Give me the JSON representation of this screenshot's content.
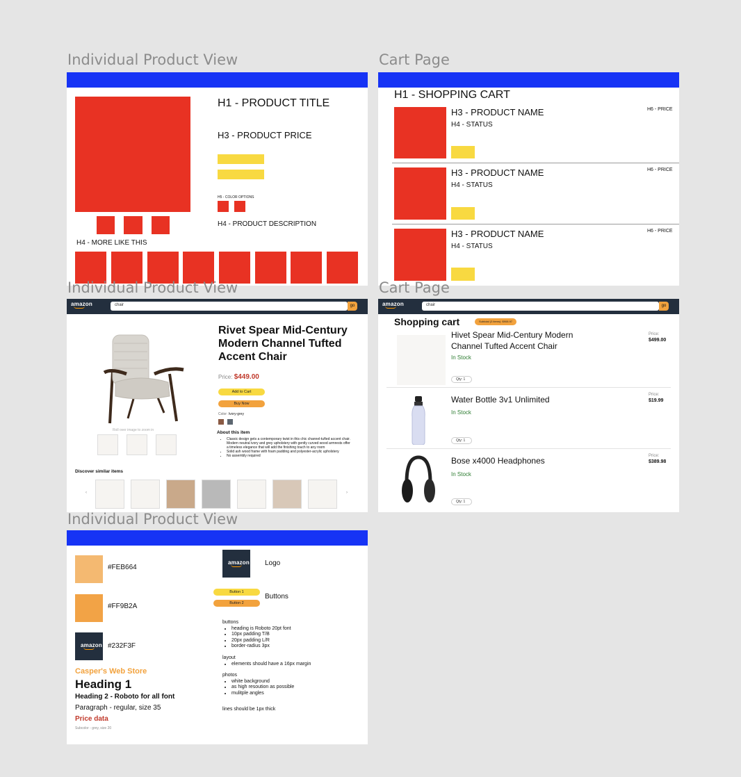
{
  "frames": {
    "wire_product_label": "Individual Product View",
    "wire_cart_label": "Cart Page",
    "hifi_product_label": "Individual Product View",
    "hifi_cart_label": "Cart Page",
    "style_label": "Individual Product View"
  },
  "wire_product": {
    "title": "H1 - PRODUCT TITLE",
    "price": "H3 - PRODUCT PRICE",
    "color_options": "H5 - COLOR OPTIONS",
    "description": "H4 - PRODUCT DESCRIPTION",
    "more_like": "H4 - MORE LIKE THIS"
  },
  "wire_cart": {
    "title": "H1 - SHOPPING CART",
    "items": [
      {
        "name": "H3 - PRODUCT NAME",
        "status": "H4 - STATUS",
        "price": "H6 - PRICE"
      },
      {
        "name": "H3 - PRODUCT NAME",
        "status": "H4 - STATUS",
        "price": "H6 - PRICE"
      },
      {
        "name": "H3 - PRODUCT NAME",
        "status": "H4 - STATUS",
        "price": "H6 - PRICE"
      }
    ]
  },
  "nav": {
    "logo": "amazon",
    "search_value": "chair",
    "go": "go"
  },
  "product": {
    "title": "Rivet Spear Mid-Century Modern Channel Tufted Accent Chair",
    "price_label": "Price:",
    "price": "$449.00",
    "add_to_cart": "Add to Cart",
    "buy_now": "Buy Now",
    "color_label": "Color:",
    "color_value": "Ivory-grey",
    "rollover": "Roll over image to zoom in",
    "about_title": "About this item",
    "about": [
      "Classic design gets a contemporary twist in this chic channel-tufted accent chair. Modern neutral ivory and grey upholstery with gently curved wood armrests offer a timeless elegance that will add the finishing touch to any room",
      "Solid ash wood frame with foam padding and polyester-acrylic upholstery",
      "No assembly required"
    ],
    "similar_title": "Discover similar items"
  },
  "cart": {
    "title": "Shopping cart",
    "subtotal": "Subtotal (3 items): $908.97",
    "items": [
      {
        "name": "Hivet Spear Mid-Century Modern Channel Tufted Accent Chair",
        "status": "In Stock",
        "price_label": "Price:",
        "price": "$499.00",
        "qty": "Qty: 1"
      },
      {
        "name": "Water Bottle 3v1 Unlimited",
        "status": "In Stock",
        "price_label": "Price:",
        "price": "$19.99",
        "qty": "Qty: 1"
      },
      {
        "name": "Bose x4000 Headphones",
        "status": "In Stock",
        "price_label": "Price:",
        "price": "$389.98",
        "qty": "Qty: 1"
      }
    ]
  },
  "style": {
    "swatches": [
      "#FEB664",
      "#FF9B2A",
      "#232F3F"
    ],
    "logo_label": "Logo",
    "buttons_label": "Buttons",
    "button1": "Button 1",
    "button2": "Button 2",
    "store_name": "Casper's Web Store",
    "heading1": "Heading 1",
    "heading2": "Heading 2 - Roboto for all font",
    "paragraph": "Paragraph - regular, size 35",
    "price_data": "Price data",
    "subcolor": "Subcolor - grey, size 20",
    "notes": {
      "buttons_title": "buttons",
      "buttons": [
        "heading is Roboto 20pt font",
        "10px padding T/B",
        "20px padding L/R",
        "border-radius 3px"
      ],
      "layout_title": "layout",
      "layout": [
        "elements should have a 16px margin"
      ],
      "photos_title": "photos",
      "photos": [
        "white background",
        "as high resoution as possible",
        "mulitple angles"
      ],
      "lines": "lines should be 1px thick"
    }
  },
  "colors": {
    "blue": "#1633F5",
    "red": "#E83223",
    "yellow": "#F8D941",
    "orange": "#F2A23D",
    "navy": "#232F3E",
    "green": "#2E7D32",
    "price_red": "#C0392B"
  }
}
